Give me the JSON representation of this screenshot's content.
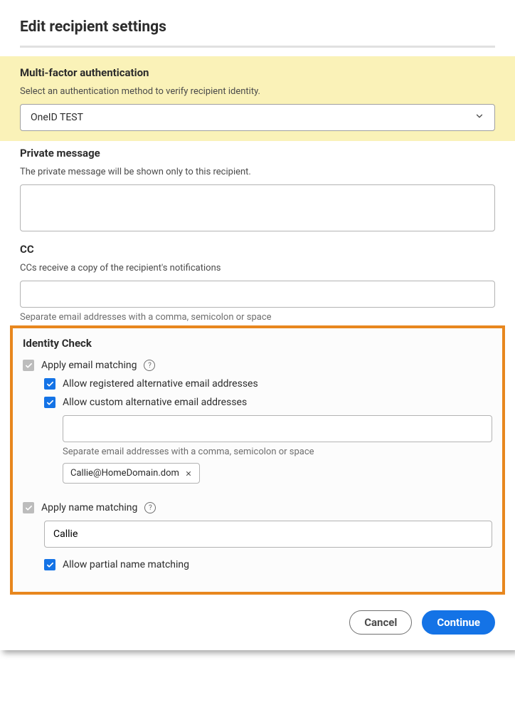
{
  "title": "Edit recipient settings",
  "mfa": {
    "heading": "Multi-factor authentication",
    "sub": "Select an authentication method to verify recipient identity.",
    "selected": "OneID TEST"
  },
  "privateMessage": {
    "heading": "Private message",
    "sub": "The private message will be shown only to this recipient.",
    "value": ""
  },
  "cc": {
    "heading": "CC",
    "sub": "CCs receive a copy of the recipient's notifications",
    "value": "",
    "hint": "Separate email addresses with a comma, semicolon or space"
  },
  "identity": {
    "heading": "Identity Check",
    "emailMatching": {
      "label": "Apply email matching",
      "checked": true,
      "locked": true
    },
    "allowRegistered": {
      "label": "Allow registered alternative email addresses",
      "checked": true
    },
    "allowCustom": {
      "label": "Allow custom alternative email addresses",
      "checked": true,
      "inputValue": "",
      "hint": "Separate email addresses with a comma, semicolon or space",
      "chips": [
        "Callie@HomeDomain.dom"
      ]
    },
    "nameMatching": {
      "label": "Apply name matching",
      "checked": true,
      "locked": true,
      "value": "Callie"
    },
    "partialName": {
      "label": "Allow partial name matching",
      "checked": true
    }
  },
  "footer": {
    "cancel": "Cancel",
    "continue": "Continue"
  }
}
